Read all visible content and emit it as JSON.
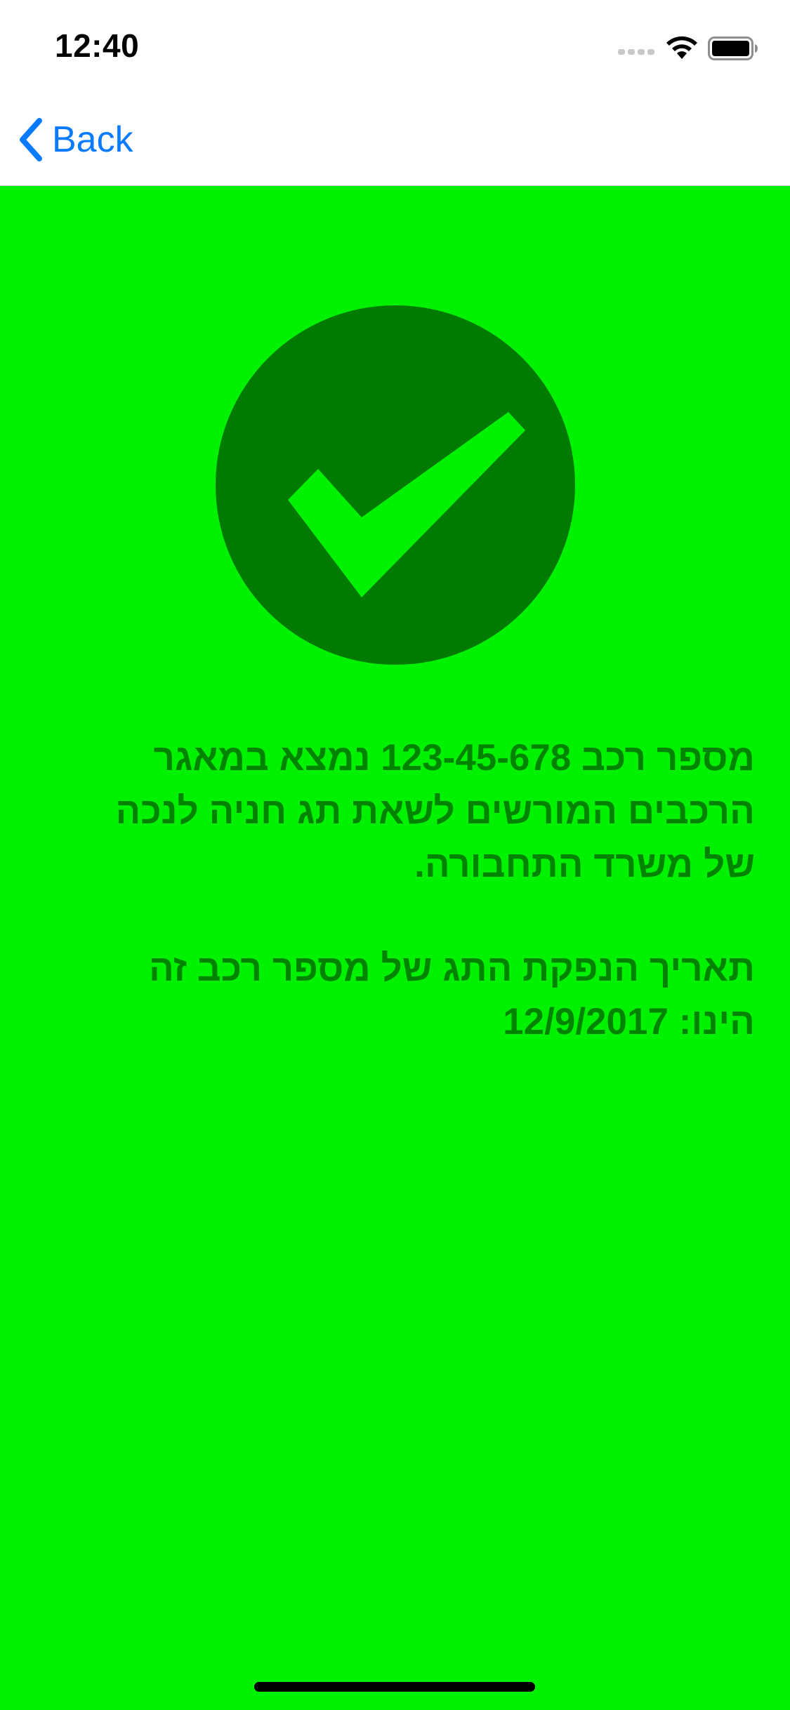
{
  "status_bar": {
    "time": "12:40",
    "signal_icon": "cellular-signal-icon",
    "wifi_icon": "wifi-icon",
    "battery_icon": "battery-icon"
  },
  "nav": {
    "back_label": "Back",
    "back_icon": "chevron-left-icon"
  },
  "result": {
    "icon": "checkmark-circle-icon",
    "message": "מספר רכב 123-45-678 נמצא במאגר הרכבים המורשים לשאת תג חניה לנכה של משרד התחבורה.",
    "date_line": "תאריך הנפקת התג של מספר רכב זה הינו: 12/9/2017"
  },
  "colors": {
    "background": "#00f200",
    "accent_dark": "#007a00",
    "text": "#008400",
    "link": "#0a7aff"
  }
}
